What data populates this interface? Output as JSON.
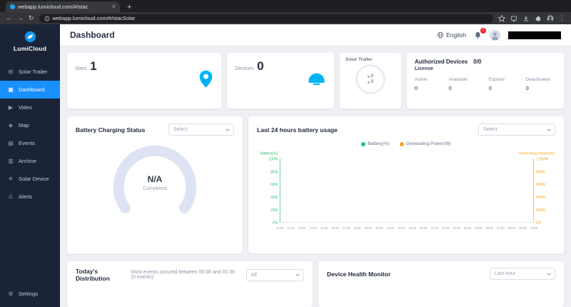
{
  "browser": {
    "tab_title": "webapp.lumicloud.com/#/stac",
    "close_tab_label": "×",
    "new_tab_label": "+",
    "back_glyph": "←",
    "forward_glyph": "→",
    "reload_glyph": "↻",
    "menu_glyph": "⋮",
    "url": "webapp.lumicloud.com/#/stacSolar"
  },
  "sidebar": {
    "logo_text": "LumiCloud",
    "items": [
      {
        "label": "Solar Trailer",
        "glyph": "⊞"
      },
      {
        "label": "Dashboard",
        "glyph": "▦",
        "active": true
      },
      {
        "label": "Video",
        "glyph": "▶"
      },
      {
        "label": "Map",
        "glyph": "◈"
      },
      {
        "label": "Events",
        "glyph": "▤"
      },
      {
        "label": "Archive",
        "glyph": "▥"
      },
      {
        "label": "Solar Device",
        "glyph": "☀"
      },
      {
        "label": "Alerts",
        "glyph": "⚠"
      }
    ],
    "settings": {
      "label": "Settings",
      "glyph": "⚙"
    }
  },
  "header": {
    "title": "Dashboard",
    "language": "English",
    "notification_count": "1"
  },
  "stats": {
    "sites": {
      "label": "Sites",
      "value": "1"
    },
    "devices": {
      "label": "Devices",
      "value": "0"
    },
    "solar_trailer": {
      "label": "Solar Trailer",
      "rows": [
        "0",
        "0"
      ]
    },
    "authorized": {
      "title": "Authorized Devices",
      "ratio": "0/0",
      "license_label": "License",
      "columns": [
        {
          "label": "Active",
          "value": "0"
        },
        {
          "label": "Available",
          "value": "0"
        },
        {
          "label": "Expired",
          "value": "0"
        },
        {
          "label": "Deactivated",
          "value": "0"
        }
      ]
    }
  },
  "battery_status": {
    "title": "Battery Charging Status",
    "select_value": "Select",
    "gauge_value": "N/A",
    "gauge_caption": "Completed"
  },
  "usage_chart": {
    "title": "Last 24 hours battery usage",
    "select_value": "Select",
    "legend": [
      {
        "label": "Battery(%)",
        "color": "#22c373"
      },
      {
        "label": "Generating Power(W)",
        "color": "#f6a623"
      }
    ],
    "y_left_title": "Battery(%)",
    "y_right_title": "Generating Power(W)",
    "y_left": [
      "100%",
      "80%",
      "60%",
      "40%",
      "20%",
      "0%"
    ],
    "y_right": [
      "1,000W",
      "800W",
      "600W",
      "400W",
      "200W",
      "0W"
    ],
    "x": [
      "11:00",
      "12:00",
      "13:00",
      "14:00",
      "15:00",
      "16:00",
      "17:00",
      "18:00",
      "19:00",
      "20:00",
      "21:00",
      "22:00",
      "23:00",
      "00:00",
      "01:00",
      "02:00",
      "03:00",
      "04:00",
      "05:00",
      "06:00",
      "07:00",
      "08:00",
      "09:00",
      "10:00"
    ]
  },
  "chart_data": {
    "type": "line",
    "title": "Last 24 hours battery usage",
    "x": [
      "11:00",
      "12:00",
      "13:00",
      "14:00",
      "15:00",
      "16:00",
      "17:00",
      "18:00",
      "19:00",
      "20:00",
      "21:00",
      "22:00",
      "23:00",
      "00:00",
      "01:00",
      "02:00",
      "03:00",
      "04:00",
      "05:00",
      "06:00",
      "07:00",
      "08:00",
      "09:00",
      "10:00"
    ],
    "series": [
      {
        "name": "Battery(%)",
        "axis": "left",
        "color": "#22c373",
        "values": []
      },
      {
        "name": "Generating Power(W)",
        "axis": "right",
        "color": "#f6a623",
        "values": []
      }
    ],
    "y_left": {
      "label": "Battery(%)",
      "range": [
        0,
        100
      ],
      "ticks": [
        "0%",
        "20%",
        "40%",
        "60%",
        "80%",
        "100%"
      ]
    },
    "y_right": {
      "label": "Generating Power(W)",
      "range": [
        0,
        1000
      ],
      "ticks": [
        "0W",
        "200W",
        "400W",
        "600W",
        "800W",
        "1,000W"
      ]
    },
    "grid": true,
    "legend_position": "top"
  },
  "distribution": {
    "title": "Today's Distribution",
    "subtitle": "Most events occured between 00:00 and 01:00 (0 events)",
    "select_value": "All"
  },
  "health": {
    "title": "Device Health Monitor",
    "select_value": "Last hour"
  },
  "colors": {
    "accent": "#1890ff",
    "icon_blue": "#00b3f5",
    "sidebar_bg": "#1b2437",
    "badge_red": "#f5222d",
    "battery_green": "#22c373",
    "power_orange": "#f6a623",
    "gauge_track": "#dde3f2"
  }
}
